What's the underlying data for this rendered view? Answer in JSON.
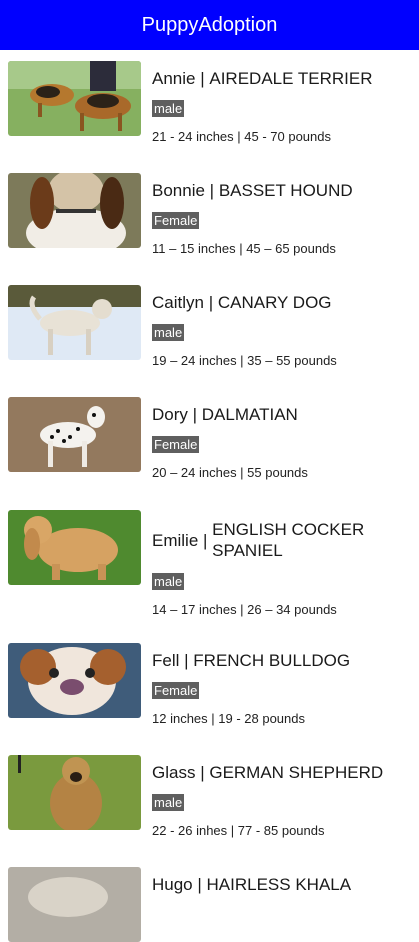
{
  "app": {
    "title": "PuppyAdoption",
    "bar_color": "#0000ff"
  },
  "puppies": [
    {
      "name": "Annie",
      "breed": "AIREDALE TERRIER",
      "gender": "male",
      "size": "21 - 24 inches | 45 - 70 pounds"
    },
    {
      "name": "Bonnie",
      "breed": "BASSET HOUND",
      "gender": "Female",
      "size": "11 – 15 inches | 45 – 65 pounds"
    },
    {
      "name": "Caitlyn",
      "breed": "CANARY DOG",
      "gender": "male",
      "size": "19 – 24 inches | 35 – 55 pounds"
    },
    {
      "name": "Dory",
      "breed": "DALMATIAN",
      "gender": "Female",
      "size": "20 – 24 inches | 55 pounds"
    },
    {
      "name": "Emilie",
      "breed": "ENGLISH COCKER SPANIEL",
      "gender": "male",
      "size": "14 – 17 inches | 26 – 34 pounds"
    },
    {
      "name": "Fell",
      "breed": "FRENCH BULLDOG",
      "gender": "Female",
      "size": "12 inches | 19 - 28 pounds"
    },
    {
      "name": "Glass",
      "breed": "GERMAN SHEPHERD",
      "gender": "male",
      "size": "22 - 26 inhes | 77 - 85 pounds"
    },
    {
      "name": "Hugo",
      "breed": "HAIRLESS KHALA"
    }
  ]
}
